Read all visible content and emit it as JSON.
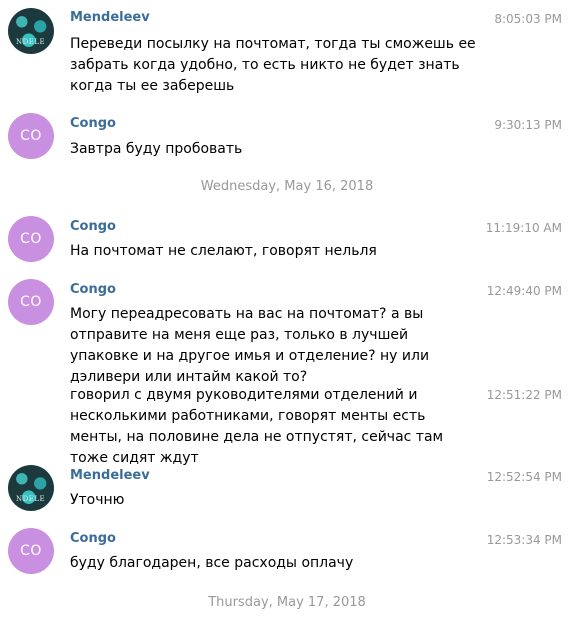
{
  "messages": [
    {
      "author": "Mendeleev",
      "avatar": "mend",
      "time": "8:05:03 PM",
      "text": "Переведи посылку на почтомат, тогда ты сможешь ее забрать когда удобно, то есть никто не будет знать когда ты ее заберешь"
    },
    {
      "author": "Congo",
      "avatar": "co",
      "avatar_text": "CO",
      "time": "9:30:13 PM",
      "text": "Завтра буду пробовать"
    },
    {
      "author": "Congo",
      "avatar": "co",
      "avatar_text": "CO",
      "time": "11:19:10 AM",
      "text": "На почтомат не слелают, говорят нельля"
    },
    {
      "author": "Congo",
      "avatar": "co",
      "avatar_text": "CO",
      "time": "12:49:40 PM",
      "text": "Могу переадресовать на вас на почтомат? а вы отправите на меня еще раз, только в лучшей упаковке и на другое имья и отделение? ну или дэливери или интайм какой то?"
    },
    {
      "author": "",
      "avatar": "",
      "time": "12:51:22 PM",
      "text": "говорил с двумя руководителями отделений и несколькими работниками, говорят менты есть менты, на половине дела не отпустят, сейчас там тоже сидят ждут"
    },
    {
      "author": "Mendeleev",
      "avatar": "mend",
      "time": "12:52:54 PM",
      "text": "Уточню"
    },
    {
      "author": "Congo",
      "avatar": "co",
      "avatar_text": "CO",
      "time": "12:53:34 PM",
      "text": "буду благодарен, все расходы оплачу"
    }
  ],
  "date_separators": [
    "Wednesday, May 16, 2018",
    "Thursday, May 17, 2018"
  ],
  "avatar_mark": "NDELE"
}
